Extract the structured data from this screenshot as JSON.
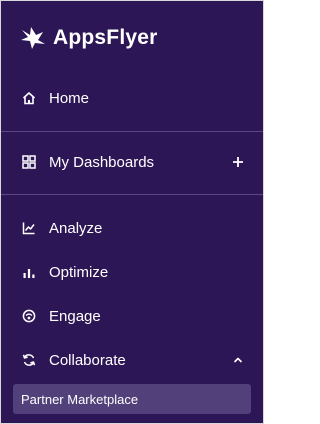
{
  "brand": {
    "name": "AppsFlyer",
    "logo_icon": "appsflyer-bird-icon"
  },
  "colors": {
    "sidebar_bg": "#2d1656",
    "divider": "#5b4882",
    "active_sub_bg": "#51407a",
    "text": "#ffffff"
  },
  "nav": {
    "home": {
      "label": "Home",
      "icon": "home-icon"
    },
    "dashboards": {
      "label": "My Dashboards",
      "icon": "dashboard-grid-icon",
      "action_icon": "plus-icon"
    },
    "analyze": {
      "label": "Analyze",
      "icon": "analyze-chart-icon"
    },
    "optimize": {
      "label": "Optimize",
      "icon": "bar-chart-icon"
    },
    "engage": {
      "label": "Engage",
      "icon": "engage-icon"
    },
    "collaborate": {
      "label": "Collaborate",
      "icon": "collaborate-refresh-icon",
      "action_icon": "chevron-up-icon",
      "expanded": true,
      "children": [
        {
          "label": "Partner Marketplace",
          "active": true
        }
      ]
    }
  }
}
